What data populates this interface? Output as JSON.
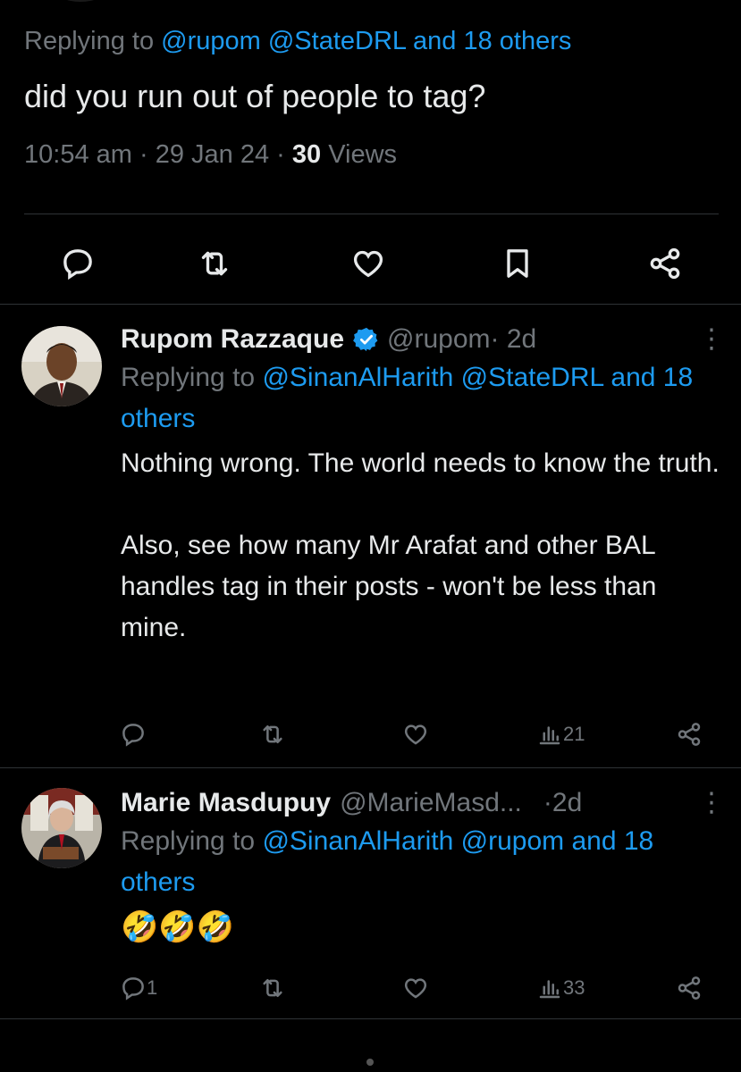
{
  "main_tweet": {
    "replying_prefix": "Replying to ",
    "replying_handles": "@rupom @StateDRL and 18 others",
    "text": "did you run out of people to tag?",
    "time": "10:54 am",
    "sep1": " · ",
    "date": "29 Jan 24",
    "sep2": " · ",
    "views_count": "30",
    "views_label": " Views"
  },
  "replies": [
    {
      "name": "Rupom Razzaque",
      "verified": true,
      "handle": "@rupom",
      "time": " · 2d",
      "replying_prefix": "Replying to ",
      "replying_handles": "@SinanAlHarith @StateDRL and 18 others",
      "text": "Nothing wrong. The world needs to know the truth.\n\nAlso, see how many Mr Arafat and other BAL handles tag in their posts - won't be less than mine.",
      "reply_count": "",
      "views": "21"
    },
    {
      "name": "Marie Masdupuy",
      "verified": false,
      "handle": "@MarieMasd...",
      "time": " ·2d",
      "replying_prefix": "Replying to ",
      "replying_handles": "@SinanAlHarith @rupom and 18 others",
      "text": "🤣🤣🤣",
      "reply_count": "1",
      "views": "33"
    }
  ],
  "colors": {
    "background": "#000000",
    "text": "#e7e9ea",
    "secondary": "#71767b",
    "accent": "#1d9bf0",
    "divider": "#2f3336"
  },
  "icons": [
    "reply-icon",
    "retweet-icon",
    "like-icon",
    "bookmark-icon",
    "share-icon",
    "views-icon",
    "more-icon",
    "verified-icon"
  ]
}
